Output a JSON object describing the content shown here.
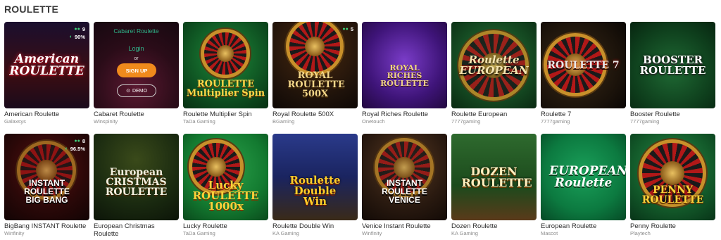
{
  "section": {
    "title": "ROULETTE"
  },
  "games": [
    {
      "name": "American Roulette",
      "provider": "Galaxsys",
      "logo": "American ROULETTE",
      "stats": {
        "players": "9",
        "rtp": "90%"
      }
    },
    {
      "name": "Cabaret Roulette",
      "provider": "Winspinity",
      "cabaret": {
        "title": "Cabaret Roulette",
        "login": "Login",
        "or": "or",
        "signup": "SIGN UP",
        "demo": "DEMO"
      }
    },
    {
      "name": "Roulette Multiplier Spin",
      "provider": "TaDa Gaming",
      "logo": "ROULETTE Multiplier Spin"
    },
    {
      "name": "Royal Roulette 500X",
      "provider": "BGaming",
      "logo": "ROYAL ROULETTE 500X",
      "stats": {
        "players": "5"
      }
    },
    {
      "name": "Royal Riches Roulette",
      "provider": "Onetouch",
      "logo": "ROYAL RICHES ROULETTE"
    },
    {
      "name": "Roulette European",
      "provider": "7777gaming",
      "logo": "Roulette EUROPEAN"
    },
    {
      "name": "Roulette 7",
      "provider": "7777gaming",
      "logo": "ROULETTE 7"
    },
    {
      "name": "Booster Roulette",
      "provider": "7777gaming",
      "logo": "BOOSTER ROULETTE"
    },
    {
      "name": "BigBang INSTANT Roulette",
      "provider": "Winfinity",
      "logo": "INSTANT ROULETTE BIG BANG",
      "stats": {
        "players": "8",
        "rtp": "96.5%"
      }
    },
    {
      "name": "European Christmas Roulette",
      "provider": "",
      "logo": "European CRISTMAS ROULETTE"
    },
    {
      "name": "Lucky Roulette",
      "provider": "TaDa Gaming",
      "logo": "Lucky ROULETTE 1000x"
    },
    {
      "name": "Roulette Double Win",
      "provider": "KA Gaming",
      "logo": "Roulette Double Win"
    },
    {
      "name": "Venice Instant Roulette",
      "provider": "Winfinity",
      "logo": "INSTANT ROULETTE VENICE"
    },
    {
      "name": "Dozen Roulette",
      "provider": "KA Gaming",
      "logo": "DOZEN ROULETTE"
    },
    {
      "name": "European Roulette",
      "provider": "Mascot",
      "logo": "EUROPEAN Roulette"
    },
    {
      "name": "Penny Roulette",
      "provider": "Playtech",
      "logo": "PENNY ROULETTE"
    }
  ],
  "colors": {
    "accent": "#f08a1c",
    "login_text": "#2fb58a",
    "stat_icon": "#3ed07a"
  },
  "icons": {
    "players": "players-icon",
    "rtp": "rtp-icon",
    "demo": "play-icon"
  }
}
